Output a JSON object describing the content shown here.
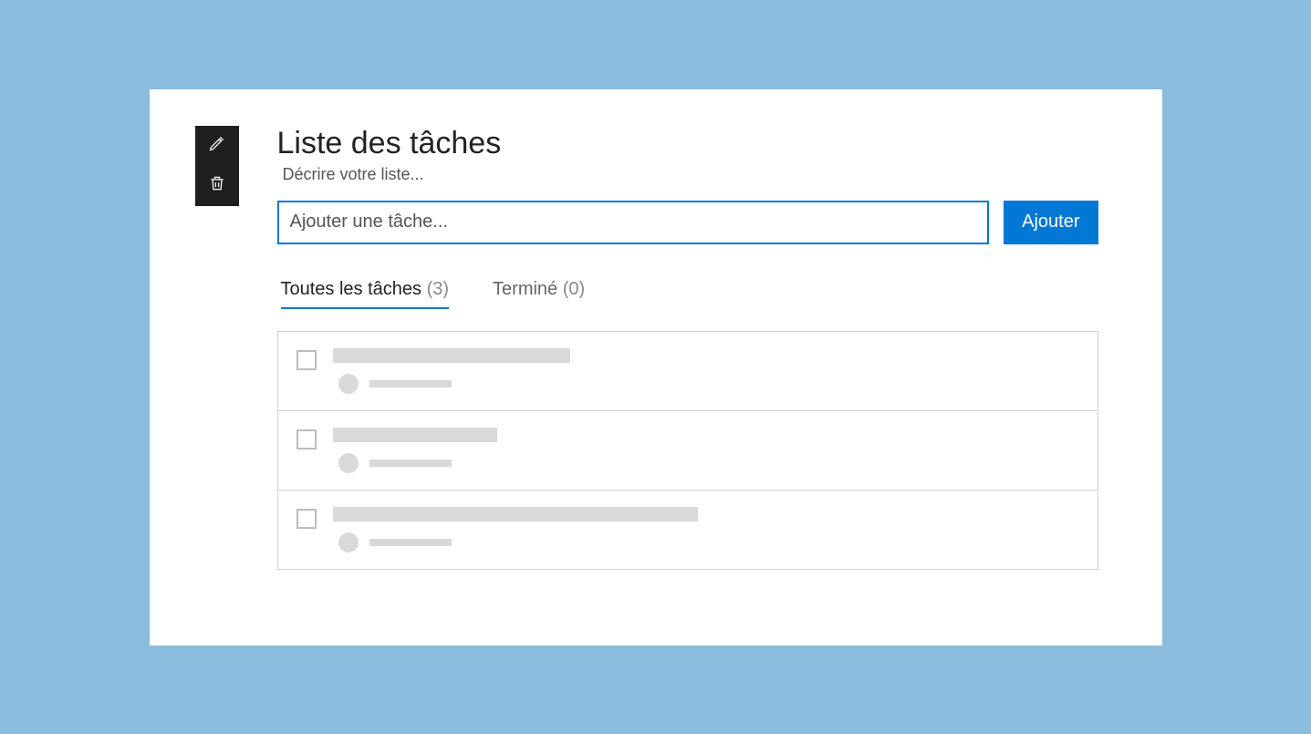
{
  "header": {
    "title": "Liste des tâches",
    "subtitle": "Décrire votre liste..."
  },
  "add": {
    "placeholder": "Ajouter une tâche...",
    "button_label": "Ajouter"
  },
  "tabs": {
    "all_label": "Toutes les tâches",
    "all_count": "(3)",
    "done_label": "Terminé",
    "done_count": "(0)"
  },
  "tasks": [
    {
      "title_width": 260
    },
    {
      "title_width": 180
    },
    {
      "title_width": 400
    }
  ]
}
